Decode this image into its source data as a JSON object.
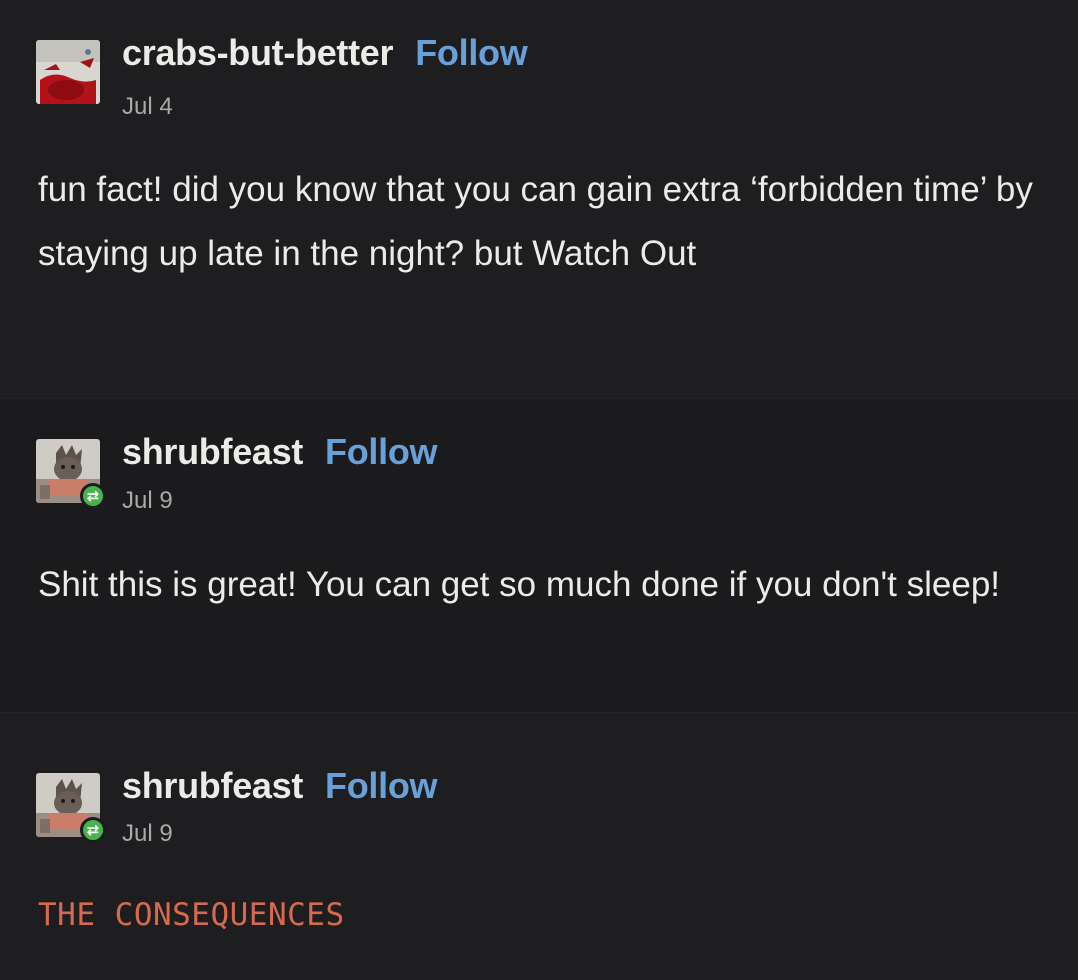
{
  "posts": [
    {
      "username": "crabs-but-better",
      "follow_label": "Follow",
      "date": "Jul 4",
      "avatar_icon": "crab-avatar",
      "reblog": false,
      "text": "fun fact! did you know that you can gain extra ‘forbidden time’ by staying up late in the night? but Watch Out"
    },
    {
      "username": "shrubfeast",
      "follow_label": "Follow",
      "date": "Jul 9",
      "avatar_icon": "creature-avatar",
      "reblog": true,
      "reblog_icon": "reblog-icon",
      "text": "Shit this is great! You can get so much done if you don't sleep!"
    },
    {
      "username": "shrubfeast",
      "follow_label": "Follow",
      "date": "Jul 9",
      "avatar_icon": "creature-avatar",
      "reblog": true,
      "reblog_icon": "reblog-icon",
      "text": "THE CONSEQUENCES"
    }
  ],
  "colors": {
    "background": "#1c1c1e",
    "text": "#ecebe7",
    "follow_link": "#6aa0d8",
    "date": "#a9a9a9",
    "reblog_badge": "#46b34b",
    "consequences_text": "#d56a4f"
  }
}
